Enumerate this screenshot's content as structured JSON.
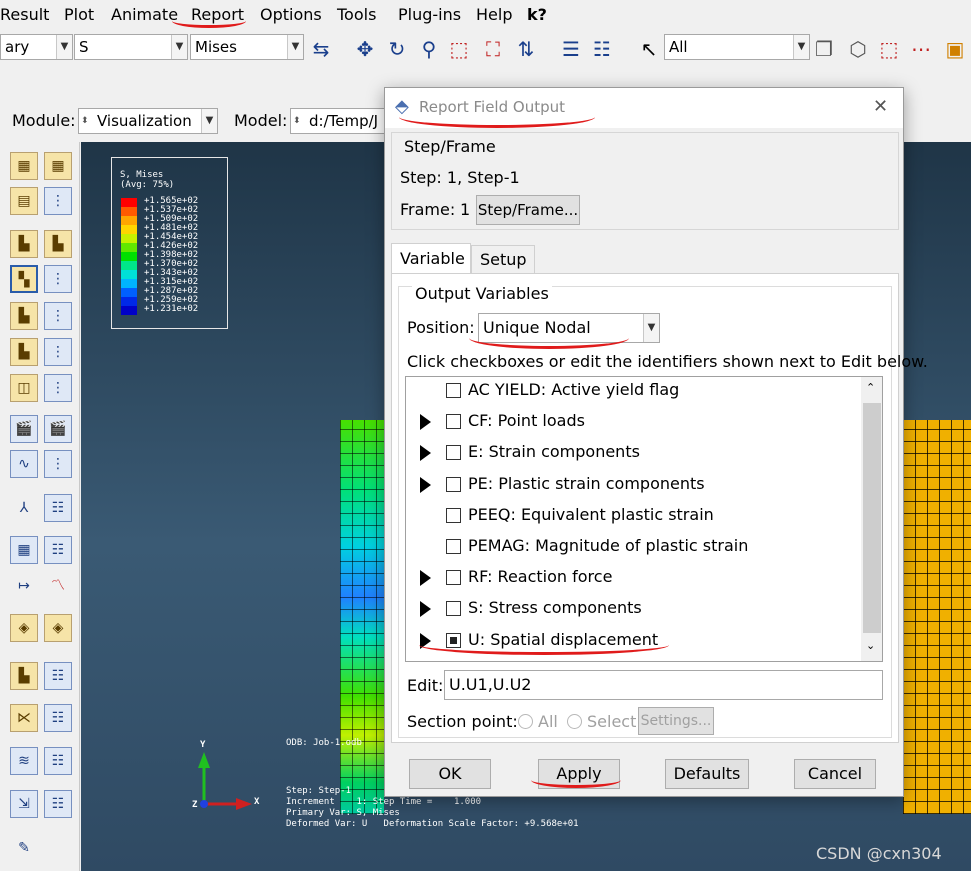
{
  "menubar": [
    "Result",
    "Plot",
    "Animate",
    "Report",
    "Options",
    "Tools",
    "Plug-ins",
    "Help",
    "k?"
  ],
  "toolbar": {
    "combo1": "ary",
    "combo2": "S",
    "combo3": "Mises",
    "combo4": "All"
  },
  "modulebar": {
    "module_label": "Module:",
    "module_value": "Visualization",
    "model_label": "Model:",
    "model_value": "d:/Temp/J"
  },
  "legend": {
    "title1": "S, Mises",
    "title2": "(Avg: 75%)",
    "values": [
      "+1.565e+02",
      "+1.537e+02",
      "+1.509e+02",
      "+1.481e+02",
      "+1.454e+02",
      "+1.426e+02",
      "+1.398e+02",
      "+1.370e+02",
      "+1.343e+02",
      "+1.315e+02",
      "+1.287e+02",
      "+1.259e+02",
      "+1.231e+02"
    ],
    "colors": [
      "#ff0000",
      "#ff5a00",
      "#ffa500",
      "#ffd500",
      "#c8f000",
      "#62e800",
      "#00e000",
      "#00e68a",
      "#00e0d8",
      "#00b4ff",
      "#0060ff",
      "#0028e8",
      "#0000c8"
    ]
  },
  "viewport": {
    "odb": "ODB: Job-1.odb",
    "info": "Step: Step-1\nIncrement    1: Step Time =    1.000\nPrimary Var: S, Mises\nDeformed Var: U   Deformation Scale Factor: +9.568e+01",
    "axis_y": "Y",
    "axis_x": "X",
    "axis_z": "Z"
  },
  "dialog": {
    "title": "Report Field Output",
    "step_group": "Step/Frame",
    "step_text": "Step: 1, Step-1",
    "frame_label": "Frame:",
    "frame_value": "1",
    "step_frame_button": "Step/Frame...",
    "tab_variable": "Variable",
    "tab_setup": "Setup",
    "output_group": "Output Variables",
    "position_label": "Position:",
    "position_value": "Unique Nodal",
    "hint": "Click checkboxes or edit the identifiers shown next to Edit below.",
    "variables": [
      {
        "label": "AC YIELD: Active yield flag",
        "expandable": false,
        "checked": false
      },
      {
        "label": "CF: Point loads",
        "expandable": true,
        "checked": false
      },
      {
        "label": "E: Strain components",
        "expandable": true,
        "checked": false
      },
      {
        "label": "PE: Plastic strain components",
        "expandable": true,
        "checked": false
      },
      {
        "label": "PEEQ: Equivalent plastic strain",
        "expandable": false,
        "checked": false
      },
      {
        "label": "PEMAG: Magnitude of plastic strain",
        "expandable": false,
        "checked": false
      },
      {
        "label": "RF: Reaction force",
        "expandable": true,
        "checked": false
      },
      {
        "label": "S: Stress components",
        "expandable": true,
        "checked": false
      },
      {
        "label": "U: Spatial displacement",
        "expandable": true,
        "checked": true
      }
    ],
    "edit_label": "Edit:",
    "edit_value": "U.U1,U.U2",
    "section_label": "Section point:",
    "section_all": "All",
    "section_select": "Select",
    "settings_button": "Settings...",
    "ok": "OK",
    "apply": "Apply",
    "defaults": "Defaults",
    "cancel": "Cancel"
  },
  "watermark": "CSDN @cxn304"
}
